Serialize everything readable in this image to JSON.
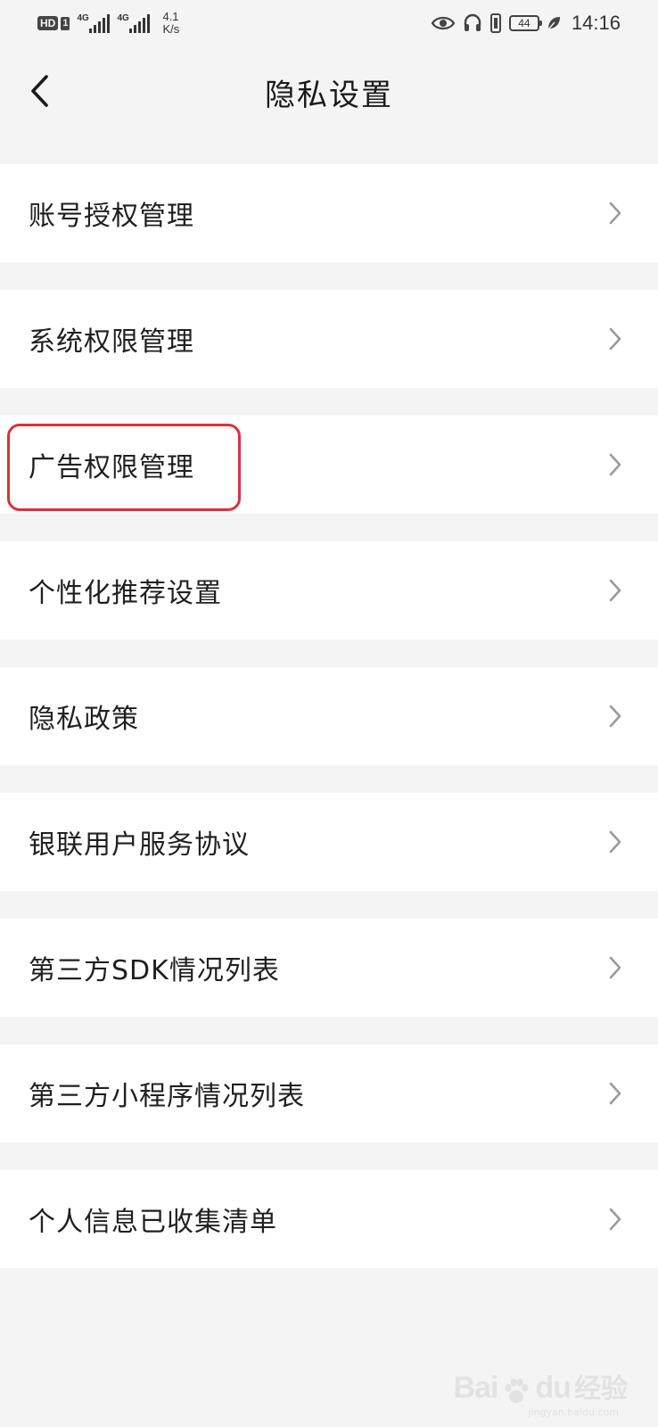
{
  "status_bar": {
    "hd_label": "HD",
    "sim_label": "1",
    "net1": "4G",
    "net2": "4G",
    "speed_value": "4.1",
    "speed_unit": "K/s",
    "battery": "44",
    "time": "14:16",
    "icons": [
      "eye-icon",
      "headphone-icon",
      "vibrate-icon",
      "battery-icon",
      "leaf-icon"
    ]
  },
  "header": {
    "title": "隐私设置",
    "back_icon": "chevron-left-icon"
  },
  "settings": {
    "items": [
      {
        "label": "账号授权管理"
      },
      {
        "label": "系统权限管理"
      },
      {
        "label": "广告权限管理"
      },
      {
        "label": "个性化推荐设置"
      },
      {
        "label": "隐私政策"
      },
      {
        "label": "银联用户服务协议"
      },
      {
        "label": "第三方SDK情况列表"
      },
      {
        "label": "第三方小程序情况列表"
      },
      {
        "label": "个人信息已收集清单"
      }
    ],
    "highlighted_index": 2,
    "highlight_color": "#d7333a"
  },
  "watermark": {
    "logo": "Bai",
    "logo2": "du",
    "text": "经验",
    "url": "jingyan.baidu.com"
  }
}
